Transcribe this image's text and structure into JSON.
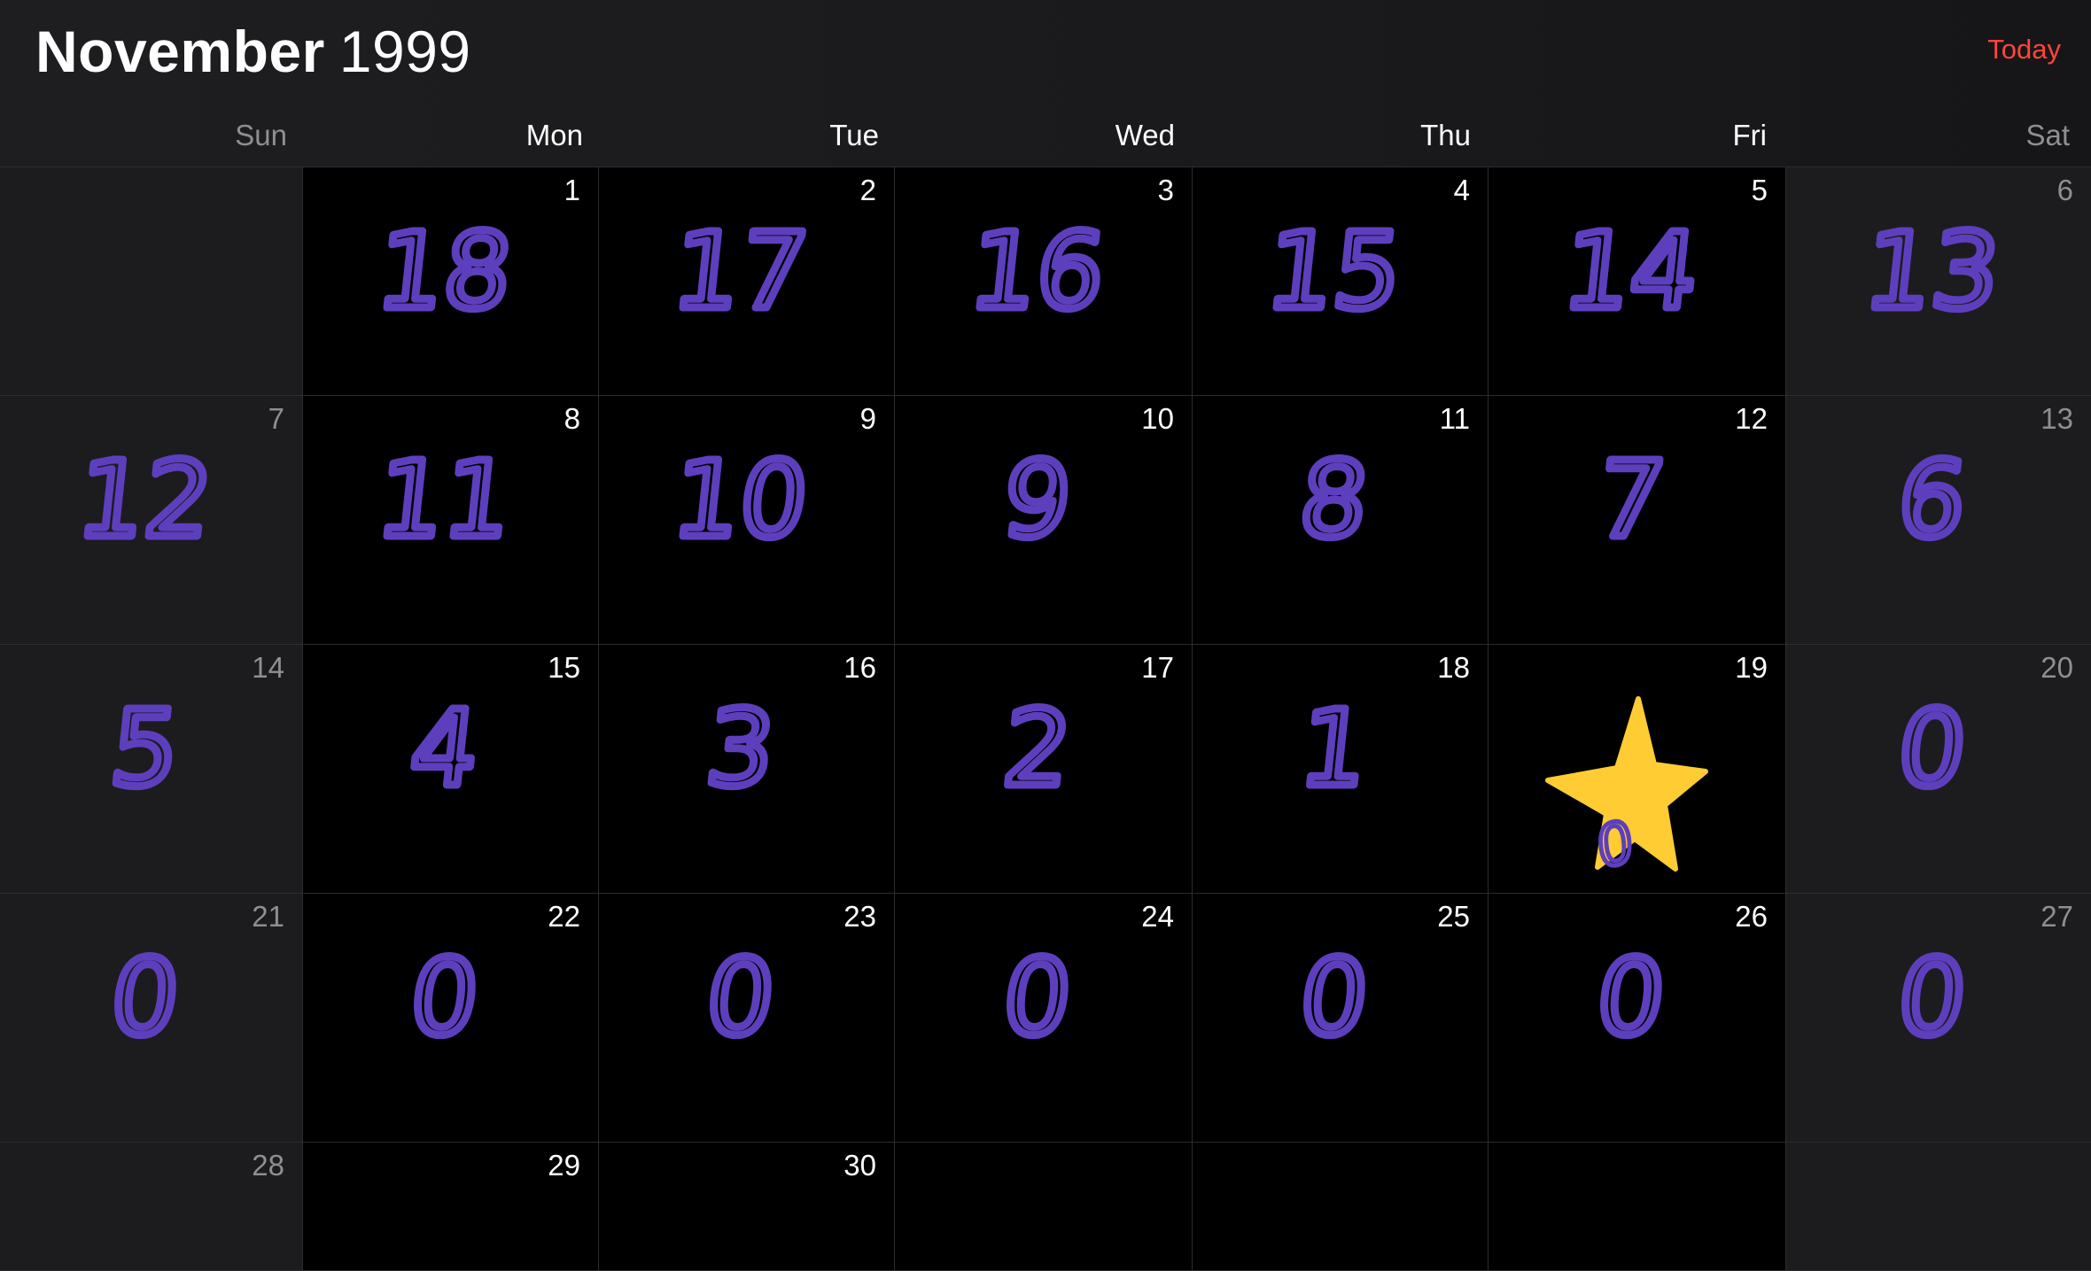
{
  "header": {
    "month": "November",
    "year": "1999",
    "today_label": "Today"
  },
  "weekdays": [
    "Sun",
    "Mon",
    "Tue",
    "Wed",
    "Thu",
    "Fri",
    "Sat"
  ],
  "colors": {
    "accent": "#ff453a",
    "ink": "#5d3fbe",
    "star": "#ffcc33"
  },
  "weeks": [
    [
      {
        "day": "",
        "mark": ""
      },
      {
        "day": "1",
        "mark": "18"
      },
      {
        "day": "2",
        "mark": "17"
      },
      {
        "day": "3",
        "mark": "16"
      },
      {
        "day": "4",
        "mark": "15"
      },
      {
        "day": "5",
        "mark": "14"
      },
      {
        "day": "6",
        "mark": "13"
      }
    ],
    [
      {
        "day": "7",
        "mark": "12"
      },
      {
        "day": "8",
        "mark": "11"
      },
      {
        "day": "9",
        "mark": "10"
      },
      {
        "day": "10",
        "mark": "9"
      },
      {
        "day": "11",
        "mark": "8"
      },
      {
        "day": "12",
        "mark": "7"
      },
      {
        "day": "13",
        "mark": "6"
      }
    ],
    [
      {
        "day": "14",
        "mark": "5"
      },
      {
        "day": "15",
        "mark": "4"
      },
      {
        "day": "16",
        "mark": "3"
      },
      {
        "day": "17",
        "mark": "2"
      },
      {
        "day": "18",
        "mark": "1"
      },
      {
        "day": "19",
        "mark": "0",
        "icon": "star-icon"
      },
      {
        "day": "20",
        "mark": "0"
      }
    ],
    [
      {
        "day": "21",
        "mark": "0"
      },
      {
        "day": "22",
        "mark": "0"
      },
      {
        "day": "23",
        "mark": "0"
      },
      {
        "day": "24",
        "mark": "0"
      },
      {
        "day": "25",
        "mark": "0"
      },
      {
        "day": "26",
        "mark": "0"
      },
      {
        "day": "27",
        "mark": "0"
      }
    ],
    [
      {
        "day": "28",
        "mark": ""
      },
      {
        "day": "29",
        "mark": ""
      },
      {
        "day": "30",
        "mark": ""
      },
      {
        "day": "",
        "mark": ""
      },
      {
        "day": "",
        "mark": ""
      },
      {
        "day": "",
        "mark": ""
      },
      {
        "day": "",
        "mark": ""
      }
    ]
  ]
}
